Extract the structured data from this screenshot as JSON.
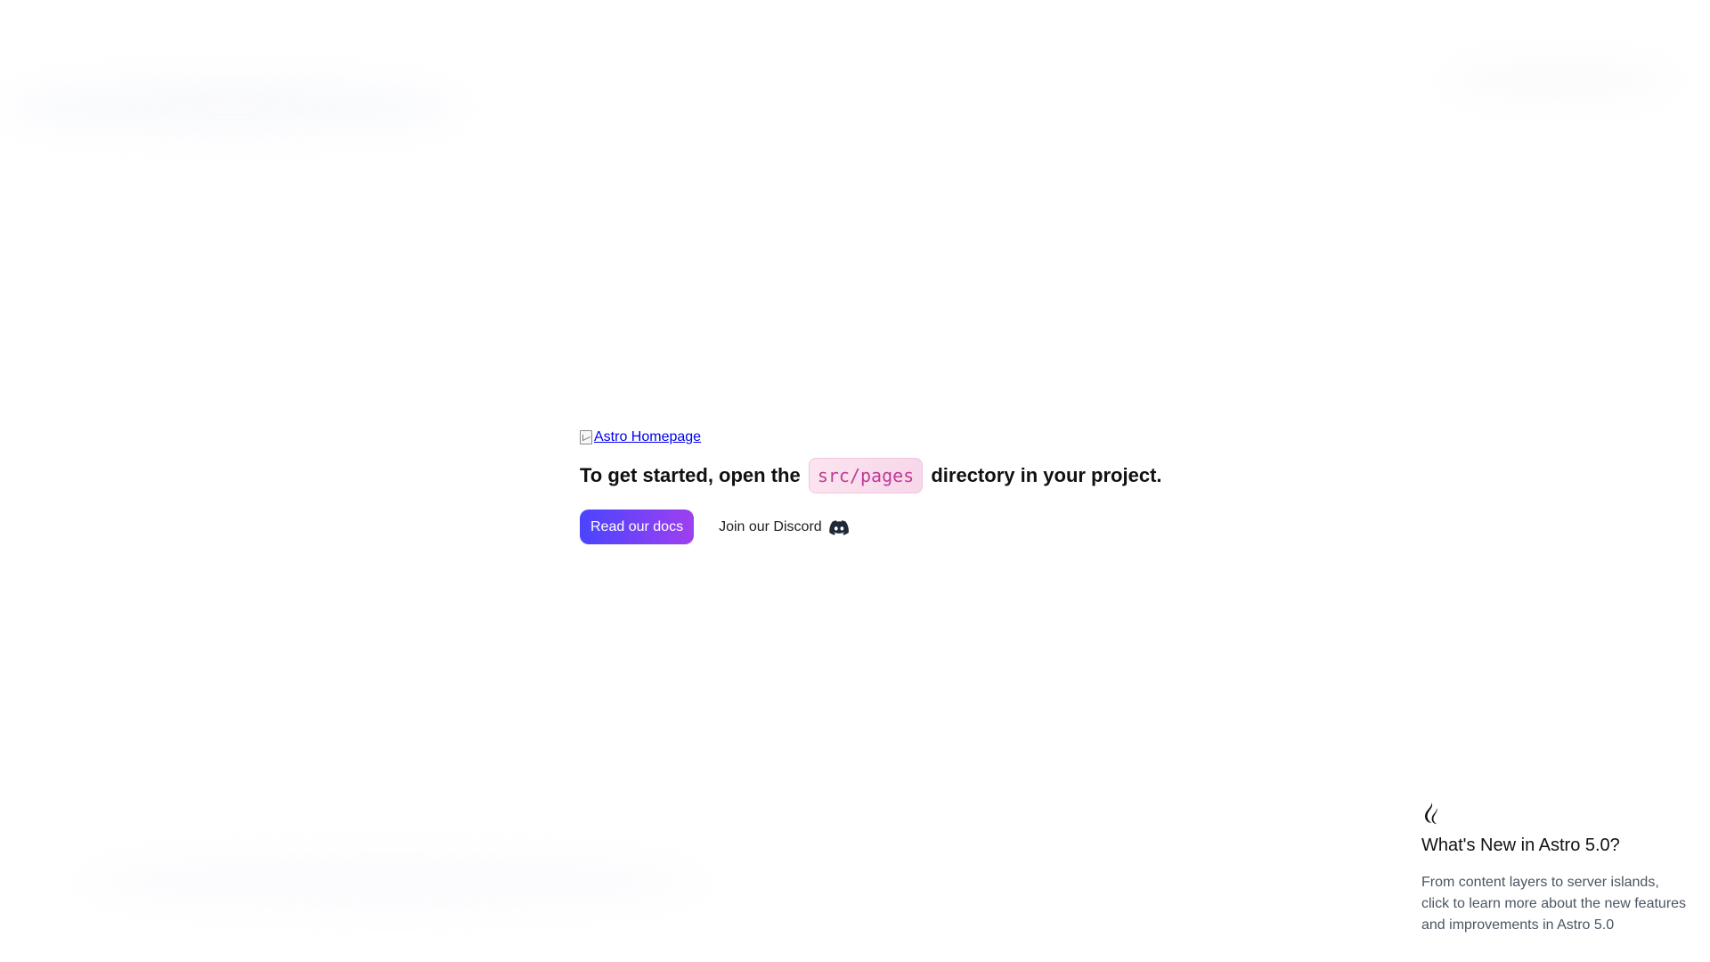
{
  "hero": {
    "home_link_text": "Astro Homepage",
    "headline_prefix": "To get started, open the",
    "code_path": "src/pages",
    "headline_suffix": "directory in your project.",
    "docs_button": "Read our docs",
    "discord_link": "Join our Discord"
  },
  "news": {
    "title": "What's New in Astro 5.0?",
    "text": "From content layers to server islands, click to learn more about the new features and improvements in Astro 5.0"
  },
  "colors": {
    "link": "#0000ee",
    "code_text": "#c03b95",
    "button_start": "#4a44ff",
    "button_end": "#9e40f0"
  },
  "icons": {
    "image_fallback": "broken-image-icon",
    "discord": "discord-icon",
    "news": "flame-icon"
  }
}
